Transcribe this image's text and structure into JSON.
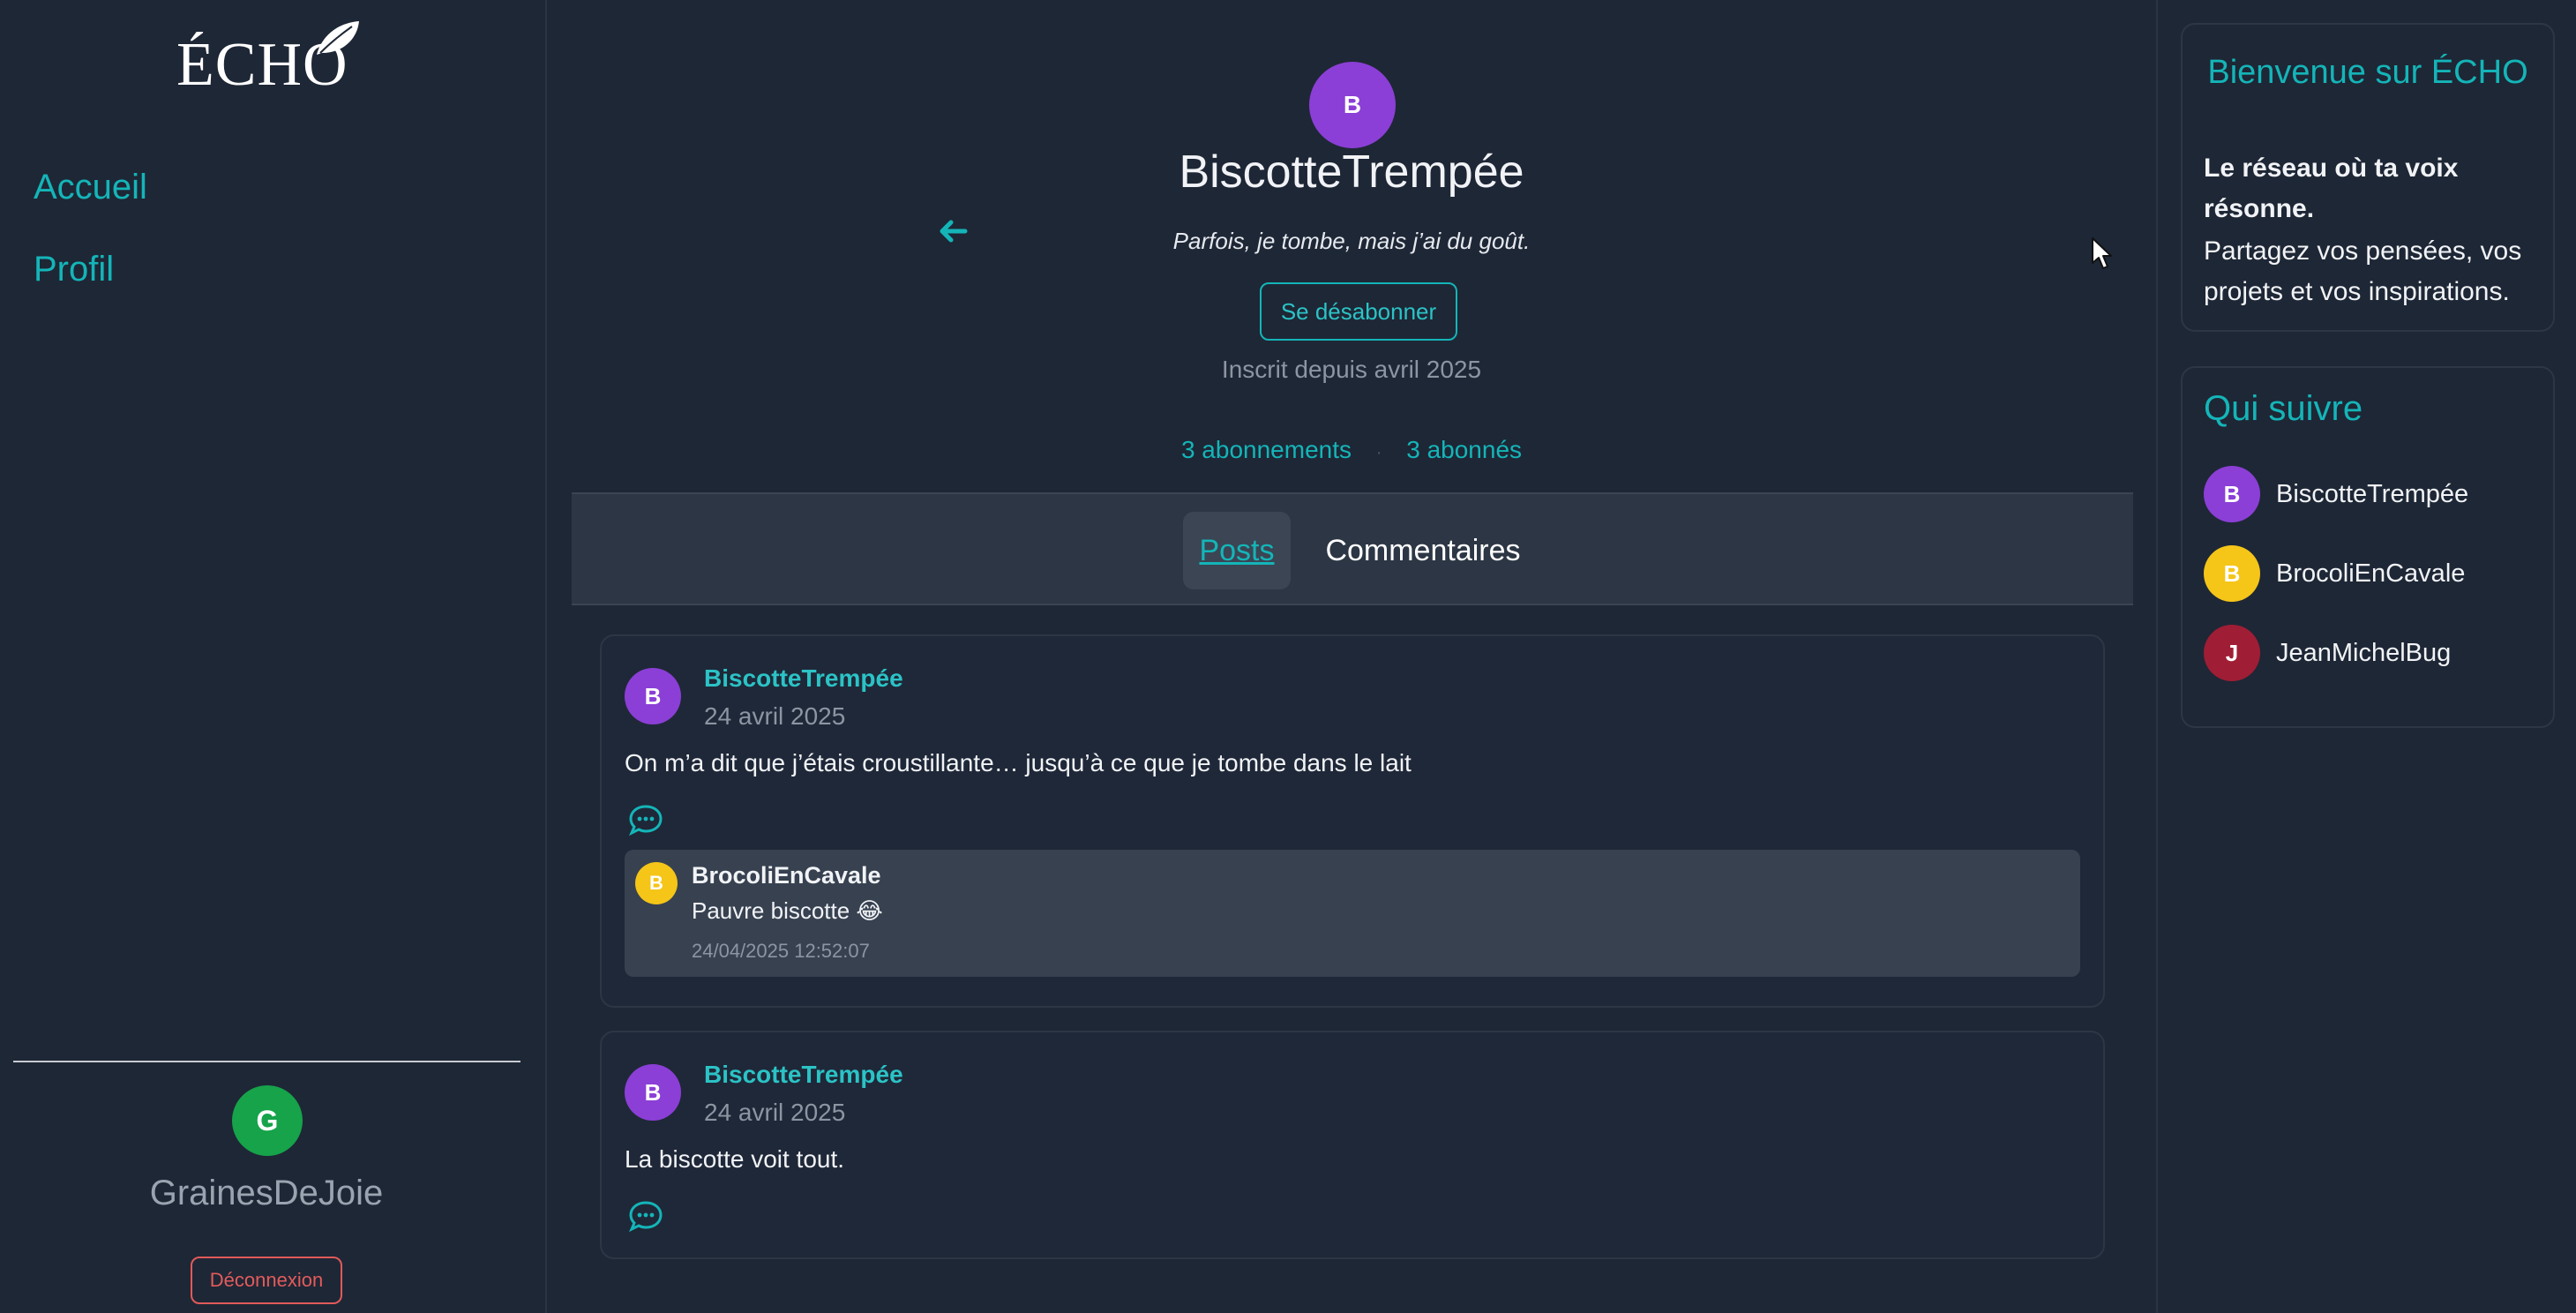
{
  "app": {
    "logo_text": "ÉCHO"
  },
  "nav": {
    "home_label": "Accueil",
    "profile_label": "Profil"
  },
  "current_user": {
    "initial": "G",
    "name": "GrainesDeJoie",
    "avatar_color": "#16a34a",
    "logout_label": "Déconnexion"
  },
  "profile": {
    "initial": "B",
    "name": "BiscotteTrempée",
    "avatar_color": "#8b3fd6",
    "bio": "Parfois, je tombe, mais j’ai du goût.",
    "unfollow_label": "Se désabonner",
    "joined": "Inscrit depuis avril 2025",
    "following": "3 abonnements",
    "separator": "·",
    "followers": "3 abonnés"
  },
  "tabs": {
    "posts": "Posts",
    "comments": "Commentaires",
    "active": "Posts"
  },
  "posts": [
    {
      "initial": "B",
      "author": "BiscotteTrempée",
      "date": "24 avril 2025",
      "text": "On m’a dit que j’étais croustillante… jusqu’à ce que je tombe dans le lait",
      "comments": [
        {
          "initial": "B",
          "author": "BrocoliEnCavale",
          "text": "Pauvre biscotte 😂",
          "timestamp": "24/04/2025 12:52:07"
        }
      ]
    },
    {
      "initial": "B",
      "author": "BiscotteTrempée",
      "date": "24 avril 2025",
      "text": "La biscotte voit tout.",
      "comments": []
    }
  ],
  "welcome": {
    "title": "Bienvenue sur ÉCHO",
    "tagline": "Le réseau où ta voix résonne.",
    "description": "Partagez vos pensées, vos projets et vos inspirations."
  },
  "suggestions": {
    "title": "Qui suivre",
    "items": [
      {
        "initial": "B",
        "name": "BiscotteTrempée",
        "color": "#8b3fd6"
      },
      {
        "initial": "B",
        "name": "BrocoliEnCavale",
        "color": "#f5c518"
      },
      {
        "initial": "J",
        "name": "JeanMichelBug",
        "color": "#9f1d35"
      }
    ]
  },
  "colors": {
    "accent": "#14b5b8",
    "background": "#1e2736",
    "danger": "#e05a5a"
  }
}
